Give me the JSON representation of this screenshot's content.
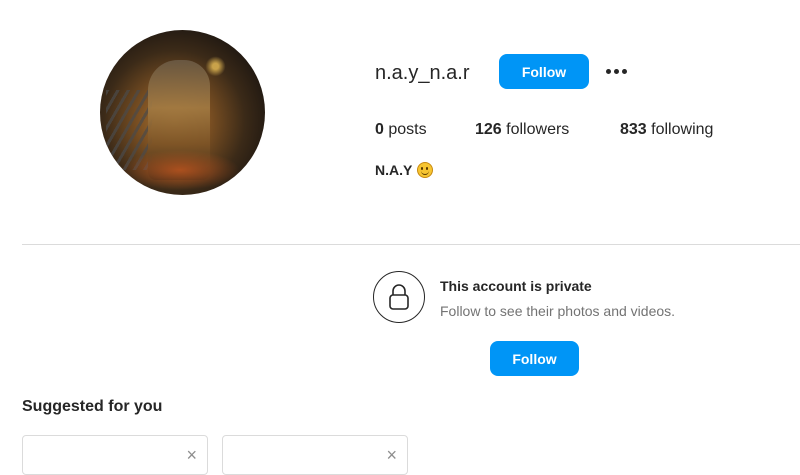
{
  "profile": {
    "username": "n.a.y_n.a.r",
    "follow_label": "Follow",
    "more_icon": "more-horizontal-icon",
    "stats": {
      "posts": {
        "count": "0",
        "label": "posts"
      },
      "followers": {
        "count": "126",
        "label": "followers"
      },
      "following": {
        "count": "833",
        "label": "following"
      }
    },
    "bio_name": "N.A.Y",
    "bio_emoji": "smiling-face-emoji"
  },
  "private_notice": {
    "icon": "lock-icon",
    "title": "This account is private",
    "subtitle": "Follow to see their photos and videos.",
    "follow_label": "Follow"
  },
  "suggestions": {
    "title": "Suggested for you",
    "cards": [
      {
        "close_icon": "close-icon",
        "close_symbol": "×"
      },
      {
        "close_icon": "close-icon",
        "close_symbol": "×"
      }
    ]
  },
  "colors": {
    "accent": "#0095f6",
    "text": "#262626",
    "secondary_text": "#737373",
    "divider": "#dbdbdb"
  }
}
